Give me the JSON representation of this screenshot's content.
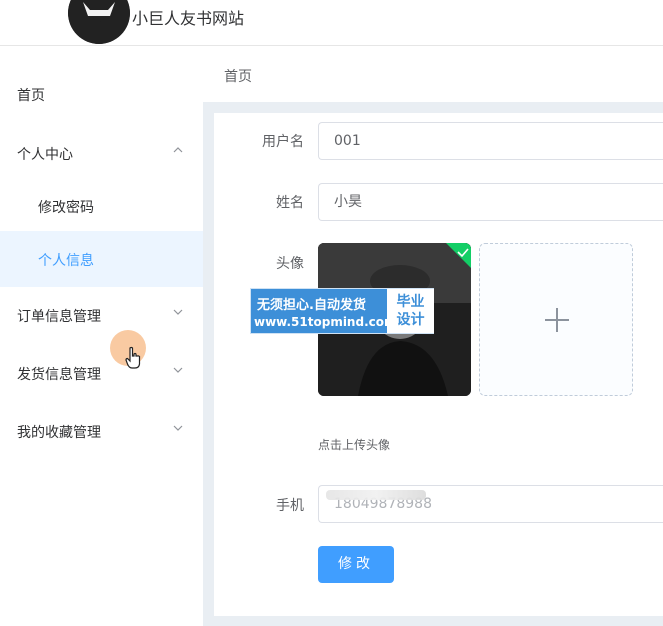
{
  "header": {
    "site_title": "小巨人友书网站",
    "logo_icon": "github-cat-icon"
  },
  "sidebar": {
    "items": [
      {
        "label": "首页"
      },
      {
        "label": "个人中心"
      },
      {
        "label": "修改密码"
      },
      {
        "label": "个人信息"
      },
      {
        "label": "订单信息管理"
      },
      {
        "label": "发货信息管理"
      },
      {
        "label": "我的收藏管理"
      }
    ],
    "active_index": 3,
    "accent_color": "#409eff"
  },
  "main": {
    "breadcrumb": "首页",
    "form": {
      "username_label": "用户名",
      "username_value": "001",
      "name_label": "姓名",
      "name_value": "小昊",
      "avatar_label": "头像",
      "upload_tip": "点击上传头像",
      "phone_label": "手机",
      "phone_value": "18049878988",
      "submit_label": "修改"
    },
    "watermark": {
      "line1": "无须担心.自动发货",
      "line2": "www.51topmind.com",
      "right1": "毕业",
      "right2": "设计"
    }
  }
}
